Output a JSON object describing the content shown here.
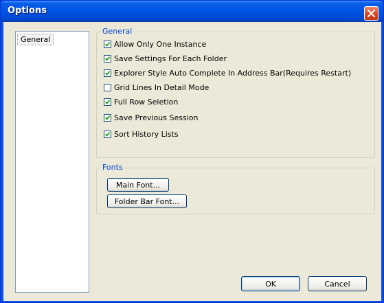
{
  "window": {
    "title": "Options"
  },
  "sidebar": {
    "items": [
      {
        "label": "General"
      }
    ]
  },
  "general": {
    "legend": "General",
    "options": [
      {
        "label": "Allow Only One Instance",
        "checked": true
      },
      {
        "label": "Save Settings For Each Folder",
        "checked": true
      },
      {
        "label": "Explorer Style Auto Complete In Address Bar(Requires Restart)",
        "checked": true
      },
      {
        "label": "Grid Lines In Detail Mode",
        "checked": false
      },
      {
        "label": "Full Row Seletion",
        "checked": true
      },
      {
        "label": "Save Previous Session",
        "checked": true
      },
      {
        "label": "Sort History Lists",
        "checked": true
      }
    ]
  },
  "fonts": {
    "legend": "Fonts",
    "main_font_label": "Main Font...",
    "folder_bar_font_label": "Folder Bar Font..."
  },
  "footer": {
    "ok_label": "OK",
    "cancel_label": "Cancel"
  }
}
